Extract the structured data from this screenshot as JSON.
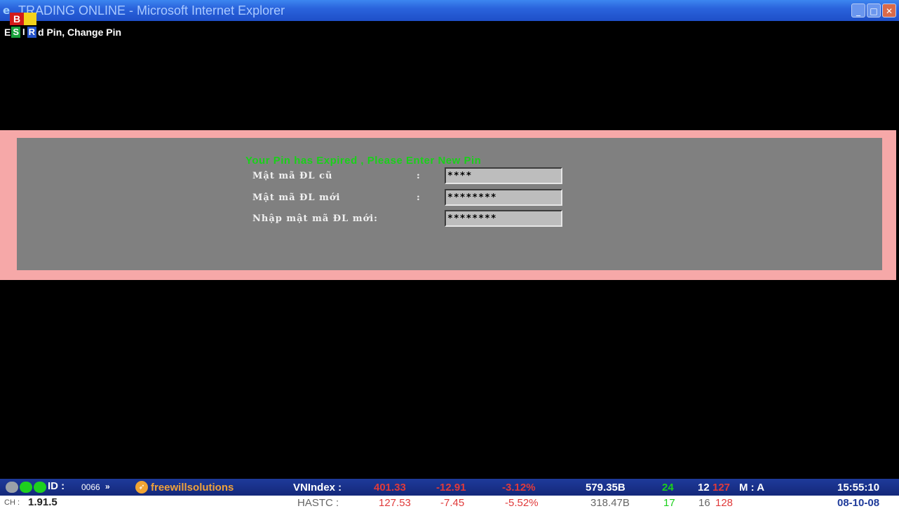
{
  "window": {
    "title": "TRADING ONLINE - Microsoft Internet Explorer",
    "icon": "ie-icon",
    "controls": [
      "minimize",
      "maximize",
      "close"
    ]
  },
  "menu": {
    "prefix": "E",
    "tags": [
      "B",
      "S",
      "I",
      "R"
    ],
    "text": "d Pin, Change Pin"
  },
  "pin_form": {
    "title": "Your Pin has Expired , Please Enter New Pin",
    "fields": [
      {
        "label": "Mật mã ĐL cũ",
        "colon": ":",
        "value": "****"
      },
      {
        "label": "Mật mã ĐL mới",
        "colon": ":",
        "value": "********"
      },
      {
        "label": "Nhập mật mã ĐL mới:",
        "colon": "",
        "value": "********"
      }
    ]
  },
  "status_bar": {
    "id_label": "ID :",
    "id_value": "0066",
    "id_more": "»",
    "brand": "freewillsolutions",
    "ch_label": "CH :",
    "ch_value": "1.91.5",
    "vnindex": {
      "label": "VNIndex :",
      "value": "401.33",
      "change": "-12.91",
      "percent": "-3.12%",
      "volume": "579.35B",
      "up": "24",
      "unchanged": "12",
      "down": "127"
    },
    "hastc": {
      "label": "HASTC :",
      "value": "127.53",
      "change": "-7.45",
      "percent": "-5.52%",
      "volume": "318.47B",
      "up": "17",
      "unchanged": "16",
      "down": "128"
    },
    "mode": "M : A",
    "time": "15:55:10",
    "date": "08-10-08"
  },
  "colors": {
    "title_bar": "#2a63dc",
    "pin_frame": "#f6a8a8",
    "pin_panel": "#808080",
    "pin_title": "#1ad01a",
    "negative": "#e03a3a",
    "positive": "#1ad01a",
    "status_bar": "#1e3a9a"
  }
}
